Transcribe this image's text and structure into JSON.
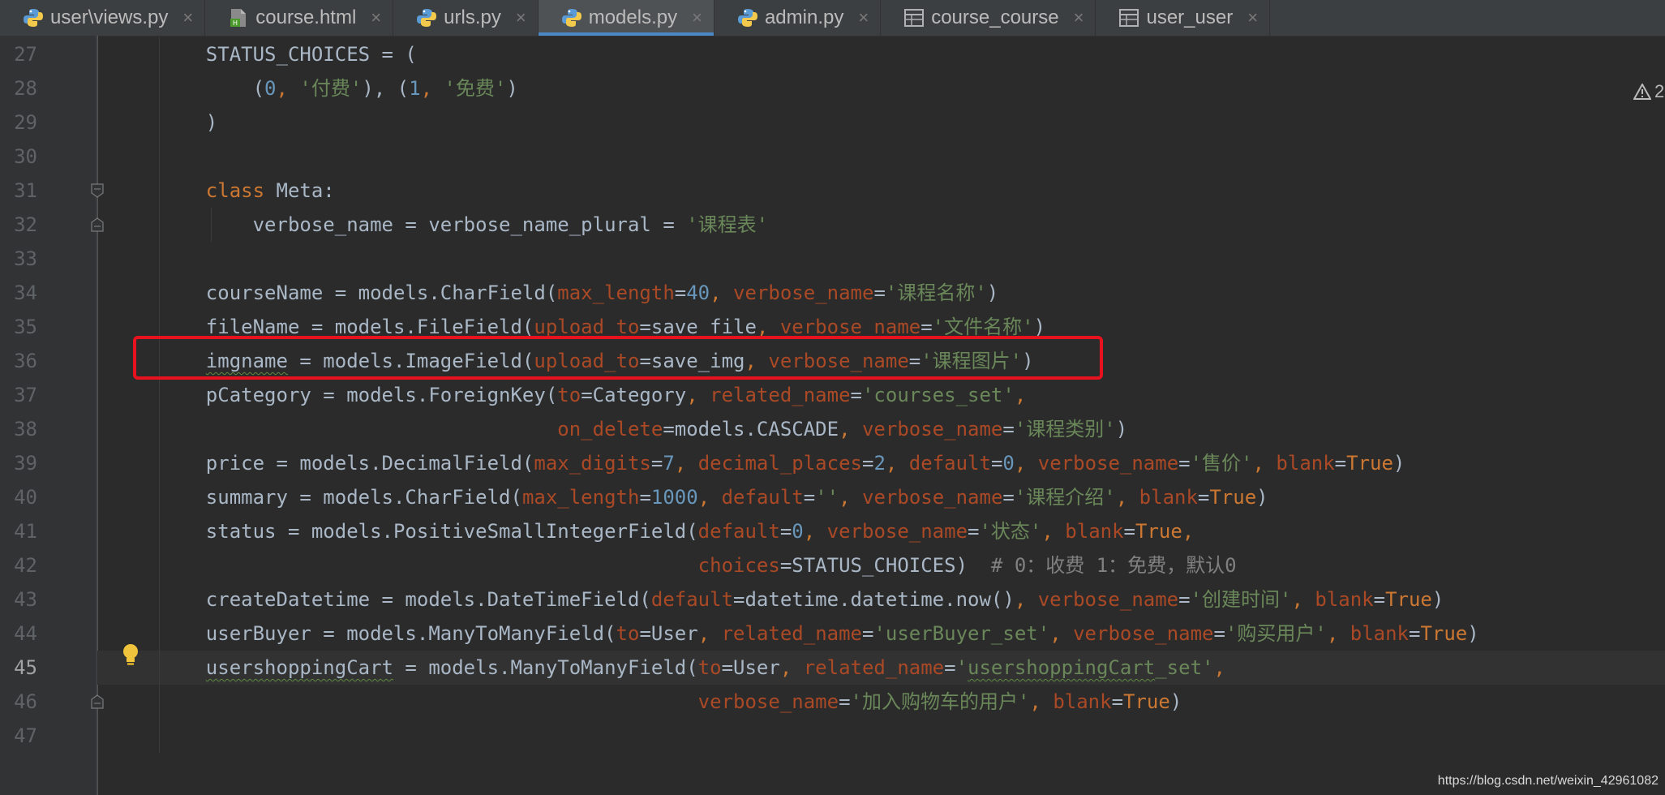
{
  "tabs": [
    {
      "label": "user\\views.py",
      "icon": "python-file-icon",
      "active": false
    },
    {
      "label": "course.html",
      "icon": "html-file-icon",
      "active": false
    },
    {
      "label": "urls.py",
      "icon": "python-file-icon",
      "active": false
    },
    {
      "label": "models.py",
      "icon": "python-file-icon",
      "active": true
    },
    {
      "label": "admin.py",
      "icon": "python-file-icon",
      "active": false
    },
    {
      "label": "course_course",
      "icon": "table-icon",
      "active": false
    },
    {
      "label": "user_user",
      "icon": "table-icon",
      "active": false
    }
  ],
  "tab_close_glyph": "×",
  "editor": {
    "current_line": 45,
    "warning_count": "2",
    "highlight_color": "#e8121f",
    "lines": [
      {
        "n": 27,
        "segs": [
          [
            "    STATUS_CHOICES = (",
            ""
          ]
        ]
      },
      {
        "n": 28,
        "segs": [
          [
            "        (",
            ""
          ],
          [
            "0",
            "num"
          ],
          [
            ", ",
            "kw"
          ],
          [
            "'付费'",
            "str"
          ],
          [
            "), (",
            ""
          ],
          [
            "1",
            "num"
          ],
          [
            ", ",
            "kw"
          ],
          [
            "'免费'",
            "str"
          ],
          [
            ")",
            ""
          ]
        ]
      },
      {
        "n": 29,
        "segs": [
          [
            "    )",
            ""
          ]
        ]
      },
      {
        "n": 30,
        "segs": [
          [
            "",
            ""
          ]
        ]
      },
      {
        "n": 31,
        "segs": [
          [
            "    ",
            ""
          ],
          [
            "class",
            "kw"
          ],
          [
            " Meta:",
            ""
          ]
        ]
      },
      {
        "n": 32,
        "segs": [
          [
            "        verbose_name = verbose_name_plural = ",
            ""
          ],
          [
            "'课程表'",
            "str"
          ]
        ]
      },
      {
        "n": 33,
        "segs": [
          [
            "",
            ""
          ]
        ]
      },
      {
        "n": 34,
        "segs": [
          [
            "    courseName = models.CharField(",
            ""
          ],
          [
            "max_length",
            "param"
          ],
          [
            "=",
            ""
          ],
          [
            "40",
            "num"
          ],
          [
            ", ",
            "kw"
          ],
          [
            "verbose_name",
            "param"
          ],
          [
            "=",
            ""
          ],
          [
            "'课程名称'",
            "str"
          ],
          [
            ")",
            ""
          ]
        ]
      },
      {
        "n": 35,
        "segs": [
          [
            "    fileName = models.FileField(",
            ""
          ],
          [
            "upload_to",
            "param"
          ],
          [
            "=save_file",
            ""
          ],
          [
            ", ",
            "kw"
          ],
          [
            "verbose_name",
            "param"
          ],
          [
            "=",
            ""
          ],
          [
            "'文件名称'",
            "str"
          ],
          [
            ")",
            ""
          ]
        ]
      },
      {
        "n": 36,
        "segs": [
          [
            "    ",
            ""
          ],
          [
            "imgname",
            "squiggle"
          ],
          [
            " = models.ImageField(",
            ""
          ],
          [
            "upload_to",
            "param"
          ],
          [
            "=save_img",
            ""
          ],
          [
            ", ",
            "kw"
          ],
          [
            "verbose_name",
            "param"
          ],
          [
            "=",
            ""
          ],
          [
            "'课程图片'",
            "str"
          ],
          [
            ")",
            ""
          ]
        ]
      },
      {
        "n": 37,
        "segs": [
          [
            "    pCategory = models.ForeignKey(",
            ""
          ],
          [
            "to",
            "param"
          ],
          [
            "=Category",
            ""
          ],
          [
            ", ",
            "kw"
          ],
          [
            "related_name",
            "param"
          ],
          [
            "=",
            ""
          ],
          [
            "'courses_set'",
            "str"
          ],
          [
            ",",
            "kw"
          ]
        ]
      },
      {
        "n": 38,
        "segs": [
          [
            "                                  ",
            ""
          ],
          [
            "on_delete",
            "param"
          ],
          [
            "=models.CASCADE",
            ""
          ],
          [
            ", ",
            "kw"
          ],
          [
            "verbose_name",
            "param"
          ],
          [
            "=",
            ""
          ],
          [
            "'课程类别'",
            "str"
          ],
          [
            ")",
            ""
          ]
        ]
      },
      {
        "n": 39,
        "segs": [
          [
            "    price = models.DecimalField(",
            ""
          ],
          [
            "max_digits",
            "param"
          ],
          [
            "=",
            ""
          ],
          [
            "7",
            "num"
          ],
          [
            ", ",
            "kw"
          ],
          [
            "decimal_places",
            "param"
          ],
          [
            "=",
            ""
          ],
          [
            "2",
            "num"
          ],
          [
            ", ",
            "kw"
          ],
          [
            "default",
            "param"
          ],
          [
            "=",
            ""
          ],
          [
            "0",
            "num"
          ],
          [
            ", ",
            "kw"
          ],
          [
            "verbose_name",
            "param"
          ],
          [
            "=",
            ""
          ],
          [
            "'售价'",
            "str"
          ],
          [
            ", ",
            "kw"
          ],
          [
            "blank",
            "param"
          ],
          [
            "=",
            ""
          ],
          [
            "True",
            "kw"
          ],
          [
            ")",
            ""
          ]
        ]
      },
      {
        "n": 40,
        "segs": [
          [
            "    summary = models.CharField(",
            ""
          ],
          [
            "max_length",
            "param"
          ],
          [
            "=",
            ""
          ],
          [
            "1000",
            "num"
          ],
          [
            ", ",
            "kw"
          ],
          [
            "default",
            "param"
          ],
          [
            "=",
            ""
          ],
          [
            "''",
            "str"
          ],
          [
            ", ",
            "kw"
          ],
          [
            "verbose_name",
            "param"
          ],
          [
            "=",
            ""
          ],
          [
            "'课程介绍'",
            "str"
          ],
          [
            ", ",
            "kw"
          ],
          [
            "blank",
            "param"
          ],
          [
            "=",
            ""
          ],
          [
            "True",
            "kw"
          ],
          [
            ")",
            ""
          ]
        ]
      },
      {
        "n": 41,
        "segs": [
          [
            "    status = models.PositiveSmallIntegerField(",
            ""
          ],
          [
            "default",
            "param"
          ],
          [
            "=",
            ""
          ],
          [
            "0",
            "num"
          ],
          [
            ", ",
            "kw"
          ],
          [
            "verbose_name",
            "param"
          ],
          [
            "=",
            ""
          ],
          [
            "'状态'",
            "str"
          ],
          [
            ", ",
            "kw"
          ],
          [
            "blank",
            "param"
          ],
          [
            "=",
            ""
          ],
          [
            "True",
            "kw"
          ],
          [
            ",",
            "kw"
          ]
        ]
      },
      {
        "n": 42,
        "segs": [
          [
            "                                              ",
            ""
          ],
          [
            "choices",
            "param"
          ],
          [
            "=STATUS_CHOICES)  ",
            ""
          ],
          [
            "# 0：收费 1：免费，默认0",
            "cm"
          ]
        ]
      },
      {
        "n": 43,
        "segs": [
          [
            "    createDatetime = models.DateTimeField(",
            ""
          ],
          [
            "default",
            "param"
          ],
          [
            "=datetime.datetime.now()",
            ""
          ],
          [
            ", ",
            "kw"
          ],
          [
            "verbose_name",
            "param"
          ],
          [
            "=",
            ""
          ],
          [
            "'创建时间'",
            "str"
          ],
          [
            ", ",
            "kw"
          ],
          [
            "blank",
            "param"
          ],
          [
            "=",
            ""
          ],
          [
            "True",
            "kw"
          ],
          [
            ")",
            ""
          ]
        ]
      },
      {
        "n": 44,
        "segs": [
          [
            "    userBuyer = models.ManyToManyField(",
            ""
          ],
          [
            "to",
            "param"
          ],
          [
            "=User",
            ""
          ],
          [
            ", ",
            "kw"
          ],
          [
            "related_name",
            "param"
          ],
          [
            "=",
            ""
          ],
          [
            "'userBuyer_set'",
            "str"
          ],
          [
            ", ",
            "kw"
          ],
          [
            "verbose_name",
            "param"
          ],
          [
            "=",
            ""
          ],
          [
            "'购买用户'",
            "str"
          ],
          [
            ", ",
            "kw"
          ],
          [
            "blank",
            "param"
          ],
          [
            "=",
            ""
          ],
          [
            "True",
            "kw"
          ],
          [
            ")",
            ""
          ]
        ]
      },
      {
        "n": 45,
        "segs": [
          [
            "    ",
            ""
          ],
          [
            "usershoppingCart",
            "squiggle"
          ],
          [
            " = models.ManyToManyField(",
            ""
          ],
          [
            "to",
            "param"
          ],
          [
            "=User",
            ""
          ],
          [
            ", ",
            "kw"
          ],
          [
            "related_name",
            "param"
          ],
          [
            "=",
            ""
          ],
          [
            "'",
            "str"
          ],
          [
            "usershoppingCart",
            "str squiggle"
          ],
          [
            "_set'",
            "str"
          ],
          [
            ",",
            "kw"
          ]
        ]
      },
      {
        "n": 46,
        "segs": [
          [
            "                                              ",
            ""
          ],
          [
            "verbose_name",
            "param"
          ],
          [
            "=",
            ""
          ],
          [
            "'加入购物车的用户'",
            "str"
          ],
          [
            ", ",
            "kw"
          ],
          [
            "blank",
            "param"
          ],
          [
            "=",
            ""
          ],
          [
            "True",
            "kw"
          ],
          [
            ")",
            ""
          ]
        ]
      },
      {
        "n": 47,
        "segs": [
          [
            "",
            ""
          ]
        ]
      }
    ]
  },
  "watermark": "https://blog.csdn.net/weixin_42961082"
}
